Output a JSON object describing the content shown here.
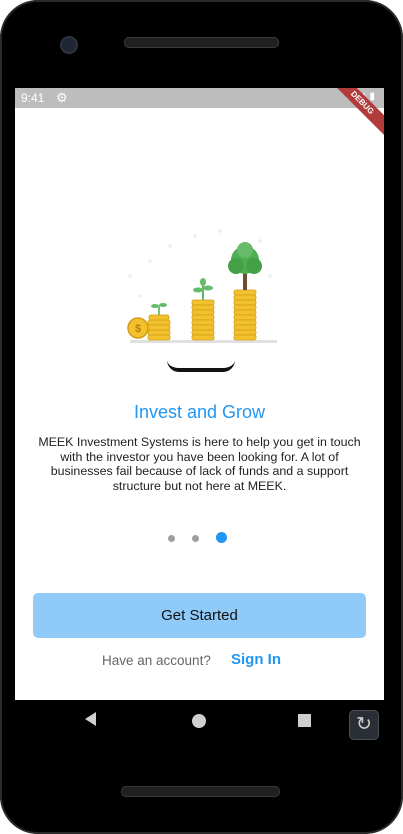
{
  "status_bar": {
    "time": "9:41",
    "settings_icon": "gear-icon",
    "signal_icons": [
      "wifi-icon",
      "signal-icon",
      "battery-icon"
    ],
    "debug_label": "DEBUG",
    "background": "#bdbdbd"
  },
  "onboarding": {
    "illustration": "coins-growth-illustration",
    "title": "Invest and Grow",
    "description": "MEEK Investment Systems is here to help you get in touch with the investor you have been looking for. A lot of businesses fail because of lack of funds and a support structure but not here at MEEK.",
    "page_count": 3,
    "current_page": 3
  },
  "actions": {
    "get_started_label": "Get Started",
    "have_account_label": "Have an account?",
    "sign_in_label": "Sign In"
  },
  "colors": {
    "accent": "#2196f3",
    "button_bg": "#90caf9",
    "dot_inactive": "#9e9e9e"
  },
  "nav_bar": {
    "back_icon": "back-triangle-icon",
    "home_icon": "home-circle-icon",
    "recent_icon": "recent-apps-square-icon",
    "rotate_icon": "rotate-icon"
  }
}
